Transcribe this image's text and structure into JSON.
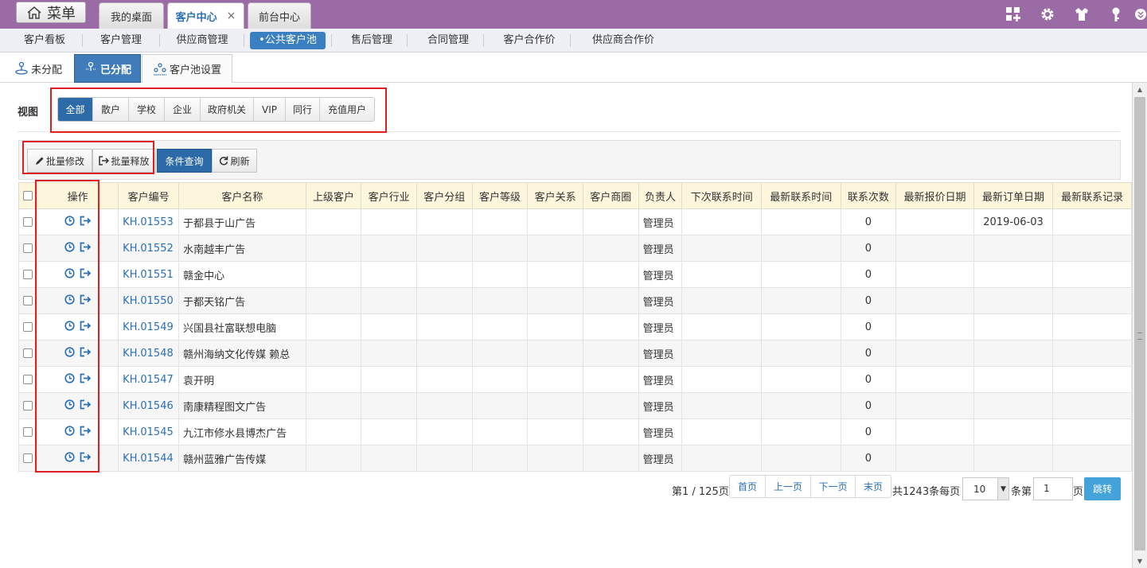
{
  "topbar": {
    "menu_label": "菜单",
    "tabs": [
      {
        "label": "我的桌面",
        "active": false,
        "closable": false
      },
      {
        "label": "客户中心",
        "active": true,
        "closable": true,
        "close_glyph": "×"
      },
      {
        "label": "前台中心",
        "active": false,
        "closable": false
      }
    ],
    "icons": [
      "grid-add-icon",
      "gear-icon",
      "shirt-icon",
      "key-icon",
      "power-icon"
    ],
    "bg_color": "#9b6ba5"
  },
  "modnav": {
    "items": [
      {
        "label": "客户看板",
        "active": false
      },
      {
        "label": "客户管理",
        "active": false
      },
      {
        "label": "供应商管理",
        "active": false
      },
      {
        "label": "•公共客户池",
        "active": true
      },
      {
        "label": "售后管理",
        "active": false
      },
      {
        "label": "合同管理",
        "active": false
      },
      {
        "label": "客户合作价",
        "active": false
      },
      {
        "label": "供应商合作价",
        "active": false
      }
    ]
  },
  "subtabs": [
    {
      "label": "未分配",
      "active": false,
      "icon": "person-pin-icon"
    },
    {
      "label": "已分配",
      "active": true,
      "icon": "person-pin-icon"
    },
    {
      "label": "客户池设置",
      "active": false,
      "icon": "users-group-icon"
    }
  ],
  "view": {
    "label": "视图",
    "filters": [
      {
        "label": "全部",
        "active": true
      },
      {
        "label": "散户",
        "active": false
      },
      {
        "label": "学校",
        "active": false
      },
      {
        "label": "企业",
        "active": false
      },
      {
        "label": "政府机关",
        "active": false
      },
      {
        "label": "VIP",
        "active": false
      },
      {
        "label": "同行",
        "active": false
      },
      {
        "label": "充值用户",
        "active": false
      }
    ]
  },
  "toolbar": {
    "batch_edit": "批量修改",
    "batch_release": "批量释放",
    "query": "条件查询",
    "refresh": "刷新"
  },
  "table": {
    "headers": [
      "操作",
      "客户编号",
      "客户名称",
      "上级客户",
      "客户行业",
      "客户分组",
      "客户等级",
      "客户关系",
      "客户商圈",
      "负责人",
      "下次联系时间",
      "最新联系时间",
      "联系次数",
      "最新报价日期",
      "最新订单日期",
      "最新联系记录"
    ],
    "rows": [
      {
        "code": "KH.01553",
        "name": "于都县于山广告",
        "owner": "管理员",
        "contact_count": "0",
        "last_order_date": "2019-06-03"
      },
      {
        "code": "KH.01552",
        "name": "水南越丰广告",
        "owner": "管理员",
        "contact_count": "0",
        "last_order_date": ""
      },
      {
        "code": "KH.01551",
        "name": "赣金中心",
        "owner": "管理员",
        "contact_count": "0",
        "last_order_date": ""
      },
      {
        "code": "KH.01550",
        "name": "于都天铭广告",
        "owner": "管理员",
        "contact_count": "0",
        "last_order_date": ""
      },
      {
        "code": "KH.01549",
        "name": "兴国县社富联想电脑",
        "owner": "管理员",
        "contact_count": "0",
        "last_order_date": ""
      },
      {
        "code": "KH.01548",
        "name": "赣州海纳文化传媒 赖总",
        "owner": "管理员",
        "contact_count": "0",
        "last_order_date": ""
      },
      {
        "code": "KH.01547",
        "name": "袁开明",
        "owner": "管理员",
        "contact_count": "0",
        "last_order_date": ""
      },
      {
        "code": "KH.01546",
        "name": "南康精程图文广告",
        "owner": "管理员",
        "contact_count": "0",
        "last_order_date": ""
      },
      {
        "code": "KH.01545",
        "name": "九江市修水县博杰广告",
        "owner": "管理员",
        "contact_count": "0",
        "last_order_date": ""
      },
      {
        "code": "KH.01544",
        "name": "赣州蓝雅广告传媒",
        "owner": "管理员",
        "contact_count": "0",
        "last_order_date": ""
      }
    ]
  },
  "pager": {
    "page_info": "第1 / 125页",
    "first": "首页",
    "prev": "上一页",
    "next": "下一页",
    "last": "末页",
    "total": "共1243条每页",
    "page_size": "10",
    "rows_jump": "条第",
    "page_input": "1",
    "page_suffix": "页",
    "go": "跳转"
  },
  "colors": {
    "accent": "#2c6aa8",
    "link": "#2a6fb4",
    "highlight": "#e02020",
    "header_bg": "#fdf5dc"
  }
}
